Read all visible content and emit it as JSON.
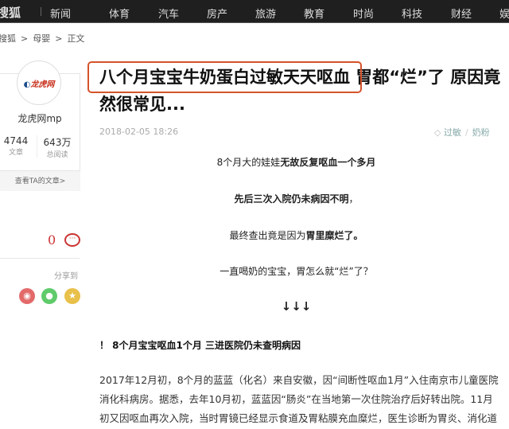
{
  "nav": {
    "logo": "搜狐",
    "items": [
      "新闻",
      "体育",
      "汽车",
      "房产",
      "旅游",
      "教育",
      "时尚",
      "科技",
      "财经",
      "娱"
    ]
  },
  "breadcrumb": [
    "搜狐",
    ">",
    "母婴",
    ">",
    "正文"
  ],
  "author": {
    "logo_text": "龙虎网",
    "name": "龙虎网mp",
    "articles": "4744",
    "articles_label": "文章",
    "reads": "643万",
    "reads_label": "总阅读",
    "more": "查看TA的文章>"
  },
  "comments": {
    "count": "0"
  },
  "share": {
    "label": "分享到",
    "icons": [
      "weibo-icon",
      "wechat-icon",
      "favorite-icon"
    ]
  },
  "article": {
    "title_highlight": "八个月宝宝牛奶蛋白过敏天天呕血",
    "title_rest": " 胃都“烂”了 原因竟然很常见...",
    "date": "2018-02-05 18:26",
    "tags": [
      "过敏",
      "奶粉"
    ],
    "lead": [
      {
        "pre": "8个月大的娃娃",
        "bold": "无故反复呕血一个多月",
        "post": ""
      },
      {
        "pre": "",
        "bold": "先后三次入院仍未病因不明",
        "post": "，"
      },
      {
        "pre": "最终查出竟是因为",
        "bold": "胃里糜烂了。",
        "post": ""
      },
      {
        "pre": "一直喝奶的宝宝，胃怎么就“烂”了？",
        "bold": "",
        "post": ""
      }
    ],
    "arrows": "↓↓↓",
    "subhead": "！ 8个月宝宝呕血1个月 三进医院仍未查明病因",
    "body": "2017年12月初，8个月的蓝蓝（化名）来自安徽，因“间断性呕血1月”入住南京市儿童医院消化科病房。据悉，去年10月初，蓝蓝因“肠炎”在当地第一次住院治疗后好转出院。11月初又因呕血再次入院，当时胃镜已经显示食道及胃粘膜充血糜烂，医生诊断为胃炎、消化道"
  }
}
